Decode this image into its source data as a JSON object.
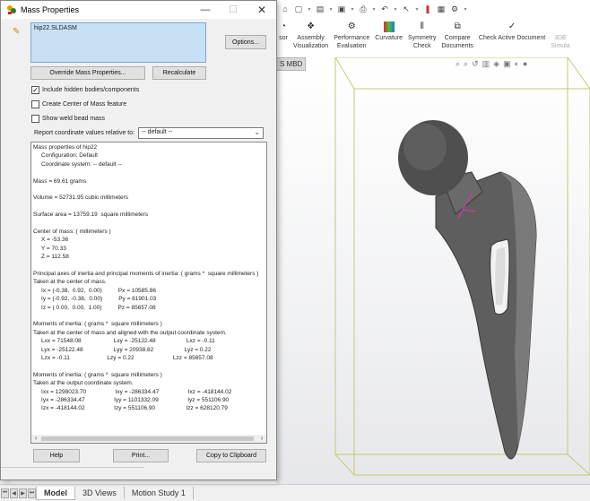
{
  "dialog": {
    "title": "Mass Properties",
    "window_controls": {
      "minimize": "—",
      "maximize": "☐",
      "close": "✕"
    },
    "selection_item": "hip22.SLDASM",
    "buttons": {
      "options": "Options...",
      "override": "Override Mass Properties...",
      "recalculate": "Recalculate",
      "help": "Help",
      "print": "Print...",
      "copy": "Copy to Clipboard"
    },
    "checkboxes": [
      {
        "label": "Include hidden bodies/components",
        "checked": true,
        "mark": "✓"
      },
      {
        "label": "Create Center of Mass feature",
        "checked": false,
        "mark": ""
      },
      {
        "label": "Show weld bead mass",
        "checked": false,
        "mark": ""
      }
    ],
    "coord_label": "Report coordinate values relative to:",
    "coord_value": "-- default --",
    "results": [
      "Mass properties of hip22",
      "     Configuration: Default",
      "     Coordinate system: -- default --",
      "",
      "Mass = 69.61 grams",
      "",
      "Volume = 52731.95 cubic millimeters",
      "",
      "Surface area = 13759.19  square millimeters",
      "",
      "Center of mass: ( millimeters )",
      "     X = -53.36",
      "     Y = 70.33",
      "     Z = 112.58",
      "",
      "Principal axes of inertia and principal moments of inertia: ( grams *  square millimeters )",
      "Taken at the center of mass.",
      "     Ix = (-0.38,  0.92,  0.00)          Px = 10585.86",
      "     Iy = (-0.92, -0.38,  0.00)          Py = 81901.03",
      "     Iz = ( 0.00,  0.00,  1.00)          Pz = 85657.08",
      "",
      "Moments of inertia: ( grams *  square millimeters )",
      "Taken at the center of mass and aligned with the output coordinate system.",
      "     Lxx = 71548.08                    Lxy = -25122.48                   Lxz = -0.11",
      "     Lyx = -25122.48                   Lyy = 20938.82                   Lyz = 0.22",
      "     Lzx = -0.11                       Lzy = 0.22                        Lzz = 85657.08",
      "",
      "Moments of inertia: ( grams *  square millimeters )",
      "Taken at the output coordinate system.",
      "     Ixx = 1298023.70                  Ixy = -286334.47                  Ixz = -418144.02",
      "     Iyx = -286334.47                  Iyy = 1101332.09                  Iyz = 551106.90",
      "     Izx = -418144.02                  Izy = 551106.90                   Izz = 628120.79"
    ]
  },
  "ribbon": {
    "items": [
      {
        "label": "sor",
        "icon": "partial-icon"
      },
      {
        "label": "Assembly\nVisualization",
        "icon": "assembly-visualization-icon"
      },
      {
        "label": "Performance\nEvaluation",
        "icon": "performance-evaluation-icon"
      },
      {
        "label": "Curvature",
        "icon": "curvature-icon"
      },
      {
        "label": "Symmetry\nCheck",
        "icon": "symmetry-check-icon"
      },
      {
        "label": "Compare\nDocuments",
        "icon": "compare-documents-icon"
      },
      {
        "label": "Check Active Document",
        "icon": "check-active-document-icon"
      },
      {
        "label": "3DE\nSimula",
        "icon": "simulation-icon"
      }
    ]
  },
  "viewport": {
    "tab_label": "S MBD"
  },
  "bottom_tabs": [
    "Model",
    "3D Views",
    "Motion Study 1"
  ],
  "colors": {
    "selection_bg": "#c7e0f4",
    "bbox": "#c8c86e",
    "part": "#5e5e5e"
  }
}
